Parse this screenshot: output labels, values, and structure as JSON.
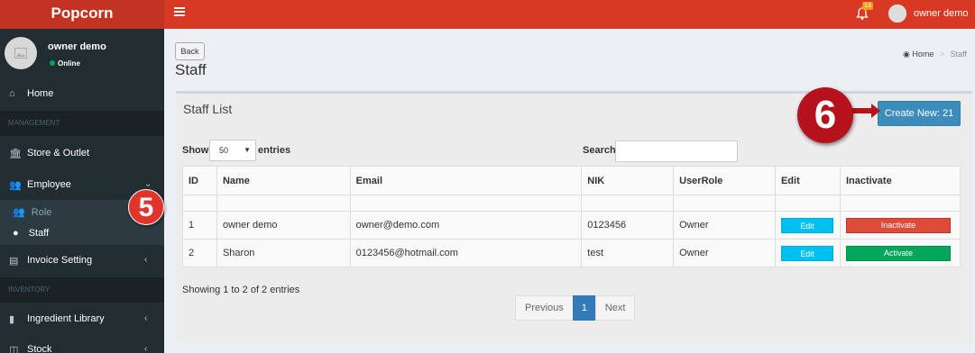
{
  "header": {
    "brand": "Popcorn",
    "notif_count": "13",
    "user_name": "owner demo"
  },
  "sidebar": {
    "user": {
      "name": "owner demo",
      "status": "Online"
    },
    "home": "Home",
    "section_management": "MANAGEMENT",
    "store": "Store & Outlet",
    "employee": "Employee",
    "role": "Role",
    "staff": "Staff",
    "invoice": "Invoice Setting",
    "section_inventory": "INVENTORY",
    "ingredient": "Ingredient Library",
    "stock": "Stock"
  },
  "page": {
    "back_label": "Back",
    "title": "Staff",
    "breadcrumb": {
      "home": "Home",
      "current": "Staff"
    }
  },
  "box": {
    "title": "Staff List",
    "create_label": "Create New: 21",
    "show_label": "Show",
    "page_size": "50",
    "entries_label": "entries",
    "search_label": "Search:"
  },
  "table": {
    "columns": [
      "ID",
      "Name",
      "Email",
      "NIK",
      "UserRole",
      "Edit",
      "Inactivate"
    ],
    "rows": [
      {
        "id": "1",
        "name": "owner demo",
        "email": "owner@demo.com",
        "nik": "0123456",
        "role": "Owner",
        "edit": "Edit",
        "action": "Inactivate"
      },
      {
        "id": "2",
        "name": "Sharon",
        "email": "0123456@hotmail.com",
        "nik": "test",
        "role": "Owner",
        "edit": "Edit",
        "action": "Activate"
      }
    ]
  },
  "info": "Showing 1 to 2 of 2 entries",
  "pagination": {
    "prev": "Previous",
    "current": "1",
    "next": "Next"
  },
  "markers": {
    "step5": "5",
    "step6": "6"
  }
}
